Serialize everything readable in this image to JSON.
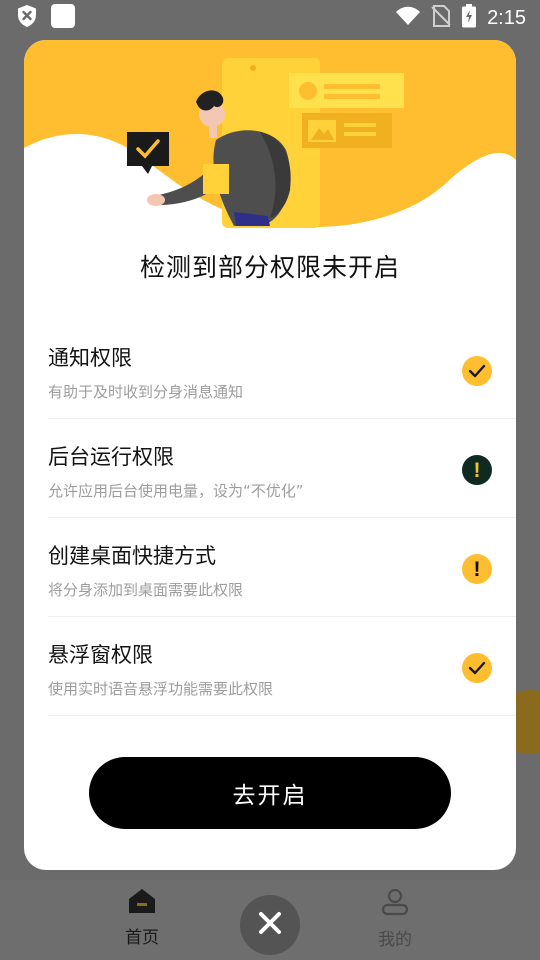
{
  "status_bar": {
    "time": "2:15",
    "icons": [
      "shield-x-icon",
      "square-app-icon",
      "wifi-icon",
      "no-sim-icon",
      "battery-charging-icon"
    ]
  },
  "dialog": {
    "title": "检测到部分权限未开启",
    "permissions": [
      {
        "name": "通知权限",
        "desc": "有助于及时收到分身消息通知",
        "status": "check"
      },
      {
        "name": "后台运行权限",
        "desc": "允许应用后台使用电量，设为“不优化”",
        "status": "warn-dark"
      },
      {
        "name": "创建桌面快捷方式",
        "desc": "将分身添加到桌面需要此权限",
        "status": "warn"
      },
      {
        "name": "悬浮窗权限",
        "desc": "使用实时语音悬浮功能需要此权限",
        "status": "check"
      }
    ],
    "button_label": "去开启"
  },
  "bottom_nav": {
    "home_label": "首页",
    "mine_label": "我的"
  },
  "colors": {
    "accent": "#ffbe30",
    "dark_badge": "#0f2a20",
    "button": "#000000"
  }
}
